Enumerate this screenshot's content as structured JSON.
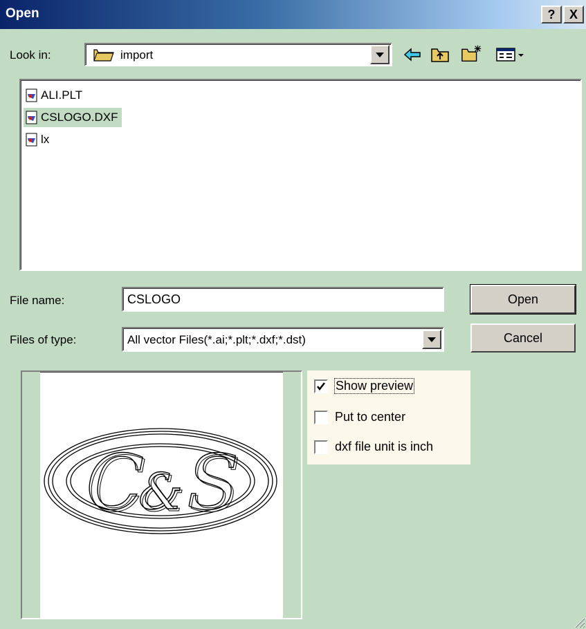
{
  "title_bar": {
    "title": "Open",
    "help_label": "?",
    "close_label": "X"
  },
  "look_in": {
    "label": "Look in:",
    "folder_name": "import"
  },
  "toolbar": {
    "icons": [
      "back-arrow-icon",
      "up-folder-icon",
      "new-folder-icon",
      "view-menu-icon"
    ]
  },
  "file_list": {
    "items": [
      {
        "name": "ALI.PLT",
        "selected": false
      },
      {
        "name": "CSLOGO.DXF",
        "selected": true
      },
      {
        "name": "lx",
        "selected": false
      }
    ]
  },
  "file_name": {
    "label": "File name:",
    "value": "CSLOGO"
  },
  "files_of_type": {
    "label": "Files of type:",
    "value": "All vector Files(*.ai;*.plt;*.dxf;*.dst)"
  },
  "buttons": {
    "open": "Open",
    "cancel": "Cancel"
  },
  "options": {
    "show_preview": {
      "label": "Show preview",
      "checked": true
    },
    "put_to_center": {
      "label": "Put to center",
      "checked": false
    },
    "dxf_unit_inch": {
      "label": "dxf file unit is inch",
      "checked": false
    }
  },
  "colors": {
    "dialog_background": "#c1dcc3",
    "title_bar_start": "#0a246a",
    "title_bar_end": "#d4e4f2",
    "selection": "#c1dcc3"
  }
}
